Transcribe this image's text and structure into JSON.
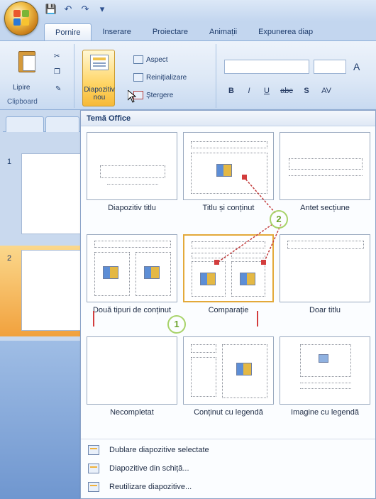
{
  "quick_access": {
    "save_icon": "save-icon",
    "undo_icon": "undo-icon",
    "redo_icon": "redo-icon",
    "customize_icon": "customize-icon"
  },
  "tabs": [
    "Pornire",
    "Inserare",
    "Proiectare",
    "Animații",
    "Expunerea diap"
  ],
  "clipboard": {
    "paste_label": "Lipire",
    "group_label": "Clipboard"
  },
  "slides_group": {
    "new_slide_label": "Diapozitiv nou",
    "layout_label": "Aspect",
    "reset_label": "Reinițializare",
    "delete_label": "Ștergere"
  },
  "font_group": {
    "bold": "B",
    "italic": "I",
    "underline": "U",
    "strike": "abc",
    "shadow": "S",
    "spacing": "AV",
    "font_label": "A"
  },
  "gallery": {
    "header": "Temă Office",
    "layouts": [
      "Diapozitiv titlu",
      "Titlu și conținut",
      "Antet secțiune",
      "Două tipuri de conținut",
      "Comparație",
      "Doar titlu",
      "Necompletat",
      "Conținut cu legendă",
      "Imagine cu legendă"
    ],
    "menu": [
      "Dublare diapozitive selectate",
      "Diapozitive din schiță...",
      "Reutilizare diapozitive..."
    ]
  },
  "slide_panel": {
    "slide_numbers": [
      "1",
      "2"
    ]
  },
  "annotations": [
    "1",
    "2"
  ]
}
